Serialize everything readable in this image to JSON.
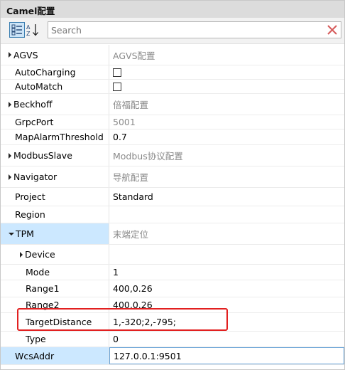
{
  "window": {
    "title": "Camel配置"
  },
  "toolbar": {
    "categorized_tooltip": "Categorized",
    "alphabetical_tooltip": "Alphabetical",
    "search_placeholder": "Search"
  },
  "rows": [
    {
      "name": "AGVS",
      "value": "AGVS配置",
      "expander": "collapsed",
      "indent": 0,
      "gray": true
    },
    {
      "name": "AutoCharging",
      "value": "",
      "checkbox": true,
      "indent": 0
    },
    {
      "name": "AutoMatch",
      "value": "",
      "checkbox": true,
      "indent": 0
    },
    {
      "name": "Beckhoff",
      "value": "倍福配置",
      "expander": "collapsed",
      "indent": 0,
      "gray": true
    },
    {
      "name": "GrpcPort",
      "value": "5001",
      "indent": 0,
      "gray": true
    },
    {
      "name": "MapAlarmThreshold",
      "value": "0.7",
      "indent": 0
    },
    {
      "name": "ModbusSlave",
      "value": "Modbus协议配置",
      "expander": "collapsed",
      "indent": 0,
      "gray": true
    },
    {
      "name": "Navigator",
      "value": "导航配置",
      "expander": "collapsed",
      "indent": 0,
      "gray": true
    },
    {
      "name": "Project",
      "value": "Standard",
      "indent": 0
    },
    {
      "name": "Region",
      "value": "",
      "indent": 0
    },
    {
      "name": "TPM",
      "value": "末端定位",
      "expander": "expanded",
      "indent": 0,
      "gray": true,
      "selected": true
    },
    {
      "name": "Device",
      "value": "",
      "expander": "collapsed",
      "indent": 1
    },
    {
      "name": "Mode",
      "value": "1",
      "indent": 1
    },
    {
      "name": "Range1",
      "value": "400,0.26",
      "indent": 1
    },
    {
      "name": "Range2",
      "value": "400,0.26",
      "indent": 1
    },
    {
      "name": "TargetDistance",
      "value": "1,-320;2,-795;",
      "indent": 1
    },
    {
      "name": "Type",
      "value": "0",
      "indent": 1
    },
    {
      "name": "WcsAddr",
      "value": "127.0.0.1:9501",
      "indent": 0,
      "selected_value": true
    }
  ],
  "colors": {
    "highlight": "#e22020",
    "selection": "#cce8ff"
  }
}
